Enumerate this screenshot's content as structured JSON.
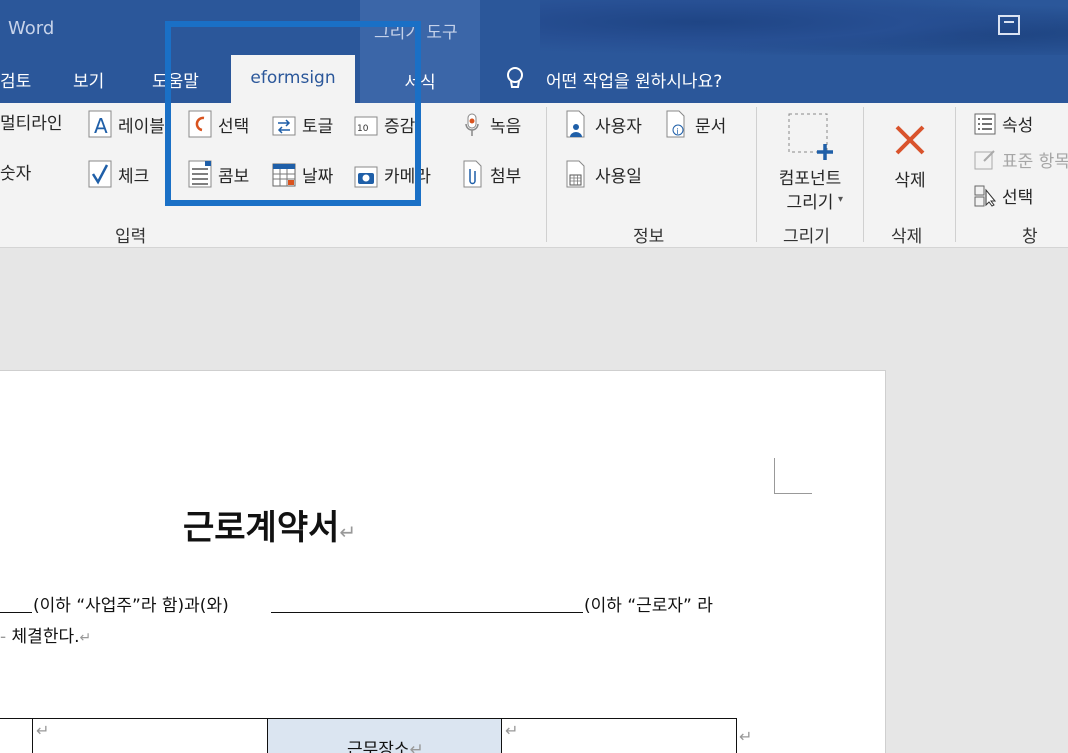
{
  "titlebar": {
    "app_name": "Word",
    "context_title": "그리기 도구"
  },
  "tabs": [
    {
      "label": "검토"
    },
    {
      "label": "보기"
    },
    {
      "label": "도움말"
    },
    {
      "label": "eformsign",
      "active": true
    },
    {
      "label": "서식"
    }
  ],
  "tellme": {
    "placeholder": "어떤 작업을 원하시나요?"
  },
  "ribbon": {
    "input_group": {
      "label": "입력",
      "items": {
        "multiline": "멀티라인",
        "label": "레이블",
        "number": "숫자",
        "check": "체크",
        "select": "선택",
        "toggle": "토글",
        "stamp": "증감",
        "combo": "콤보",
        "date": "날짜",
        "camera": "카메라",
        "record": "녹음",
        "attach": "첨부"
      }
    },
    "info_group": {
      "label": "정보",
      "items": {
        "user": "사용자",
        "document": "문서",
        "use_date": "사용일"
      }
    },
    "draw_group": {
      "label": "그리기",
      "button": "컴포넌트\n그리기"
    },
    "delete_group": {
      "label": "삭제",
      "button": "삭제"
    },
    "window_group": {
      "label": "창",
      "items": {
        "properties": "속성",
        "standard": "표준 항목",
        "select": "선택"
      }
    }
  },
  "document": {
    "title": "근로계약서",
    "line1_a": "(이하 “사업주”라 함)과(와)",
    "line1_b": "(이하 “근로자” 라",
    "line2": "체결한다.",
    "table_cell": "근무장소"
  },
  "colors": {
    "word_blue": "#2b579a",
    "highlight": "#1a70c6",
    "shaded_cell": "#dbe5f1"
  }
}
